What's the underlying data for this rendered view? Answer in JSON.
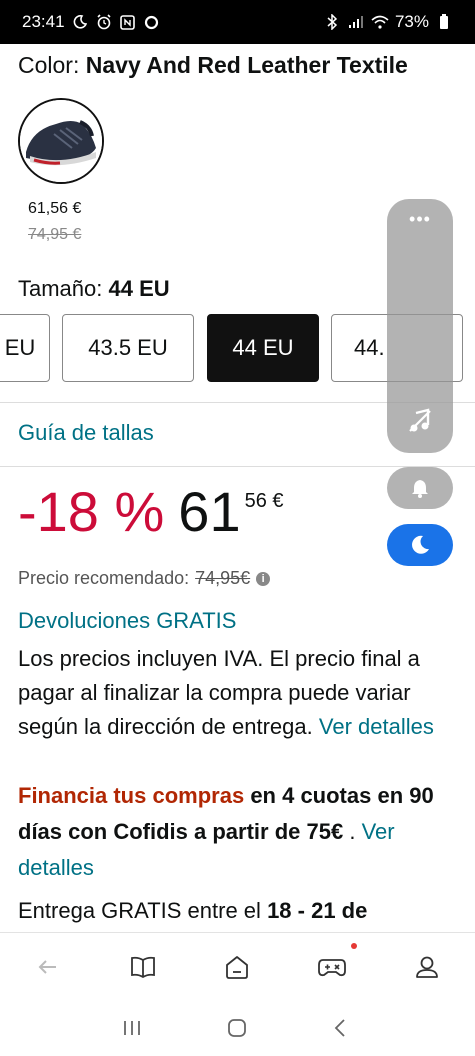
{
  "status_bar": {
    "time": "23:41",
    "battery": "73%",
    "icons": [
      "moon-icon",
      "alarm-icon",
      "nfc-icon",
      "circle-icon",
      "bluetooth-icon",
      "signal-icon",
      "wifi-icon",
      "battery-icon"
    ]
  },
  "product": {
    "color_label": "Color:",
    "color_value": "Navy And Red Leather Textile",
    "swatch_price": "61,56 €",
    "swatch_old_price": "74,95 €",
    "size_label": "Tamaño:",
    "size_value": "44 EU",
    "sizes": [
      "EU",
      "43.5 EU",
      "44 EU",
      "44."
    ],
    "selected_size_index": 2,
    "size_guide": "Guía de tallas"
  },
  "price": {
    "discount": "-18 %",
    "integer": "61",
    "fraction": "56 €",
    "recommended_label": "Precio recomendado:",
    "recommended_value": "74,95€"
  },
  "info": {
    "returns": "Devoluciones GRATIS",
    "vat_text": "Los precios incluyen IVA. El precio final a pagar al finalizar la compra puede variar según la dirección de entrega.",
    "vat_link": "Ver detalles",
    "finance_orange": "Financia tus compras",
    "finance_text": "en 4 cuotas en 90 días con Cofidis a partir de 75€",
    "finance_sep": ".",
    "finance_link": "Ver detalles",
    "delivery_text": "Entrega GRATIS entre el",
    "delivery_dates": "18 - 21 de"
  },
  "toolbar": {
    "buttons": [
      "back-icon",
      "book-icon",
      "home-icon",
      "gamepad-icon",
      "account-icon"
    ]
  },
  "navbar": {
    "buttons": [
      "recent-apps-icon",
      "home-button-icon",
      "back-nav-icon"
    ]
  },
  "colors": {
    "accent_link": "#007185",
    "discount": "#cc0c39",
    "finance": "#b12704",
    "moon_button": "#1a73e8"
  }
}
